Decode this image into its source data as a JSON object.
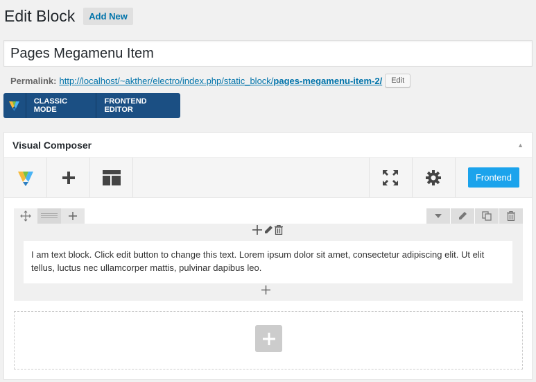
{
  "header": {
    "title": "Edit Block",
    "add_new_label": "Add New"
  },
  "post": {
    "title_value": "Pages Megamenu Item"
  },
  "permalink": {
    "label": "Permalink:",
    "url_base": "http://localhost/~akther/electro/index.php/static_block/",
    "slug": "pages-megamenu-item-2/",
    "edit_label": "Edit"
  },
  "mode_bar": {
    "classic_label": "CLASSIC MODE",
    "frontend_label": "FRONTEND EDITOR"
  },
  "visual_composer": {
    "title": "Visual Composer",
    "toolbar": {
      "frontend_label": "Frontend"
    },
    "text_block": "I am text block. Click edit button to change this text. Lorem ipsum dolor sit amet, consectetur adipiscing elit. Ut elit tellus, luctus nec ullamcorper mattis, pulvinar dapibus leo."
  },
  "colors": {
    "accent": "#1ba3ec",
    "link": "#0073aa",
    "mode_bar": "#1b4f83"
  }
}
